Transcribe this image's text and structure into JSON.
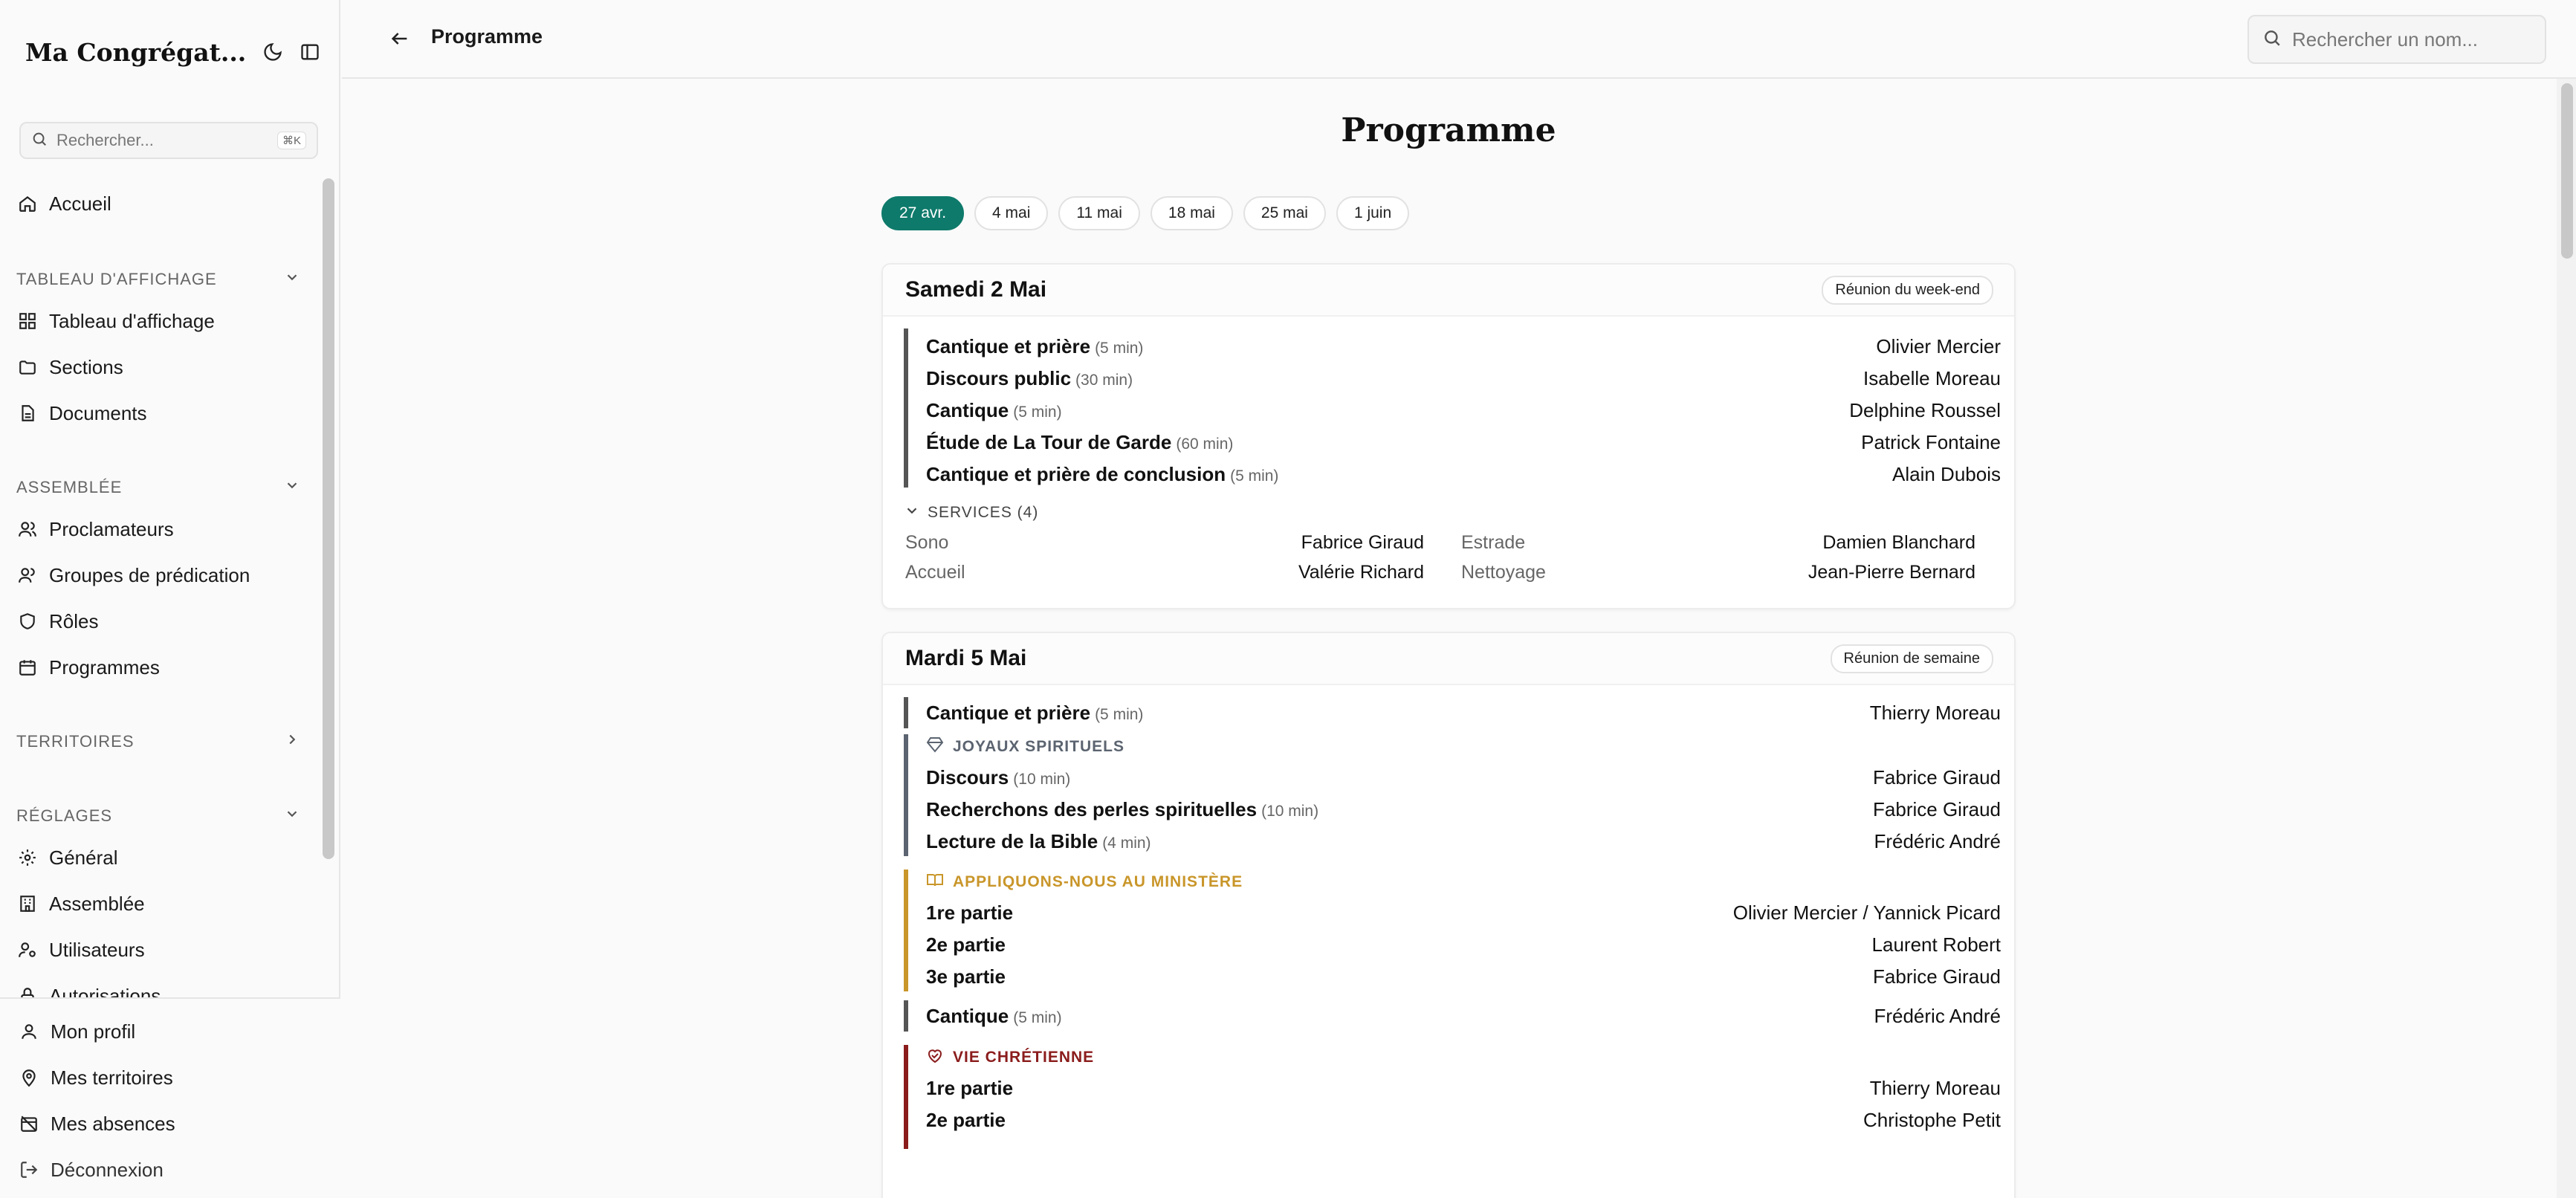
{
  "app": {
    "title": "Ma Congrégat..."
  },
  "sidebar": {
    "search_placeholder": "Rechercher...",
    "search_shortcut": "⌘K",
    "home": "Accueil",
    "groups": [
      {
        "label": "TABLEAU D'AFFICHAGE",
        "items": [
          "Tableau d'affichage",
          "Sections",
          "Documents"
        ]
      },
      {
        "label": "ASSEMBLÉE",
        "items": [
          "Proclamateurs",
          "Groupes de prédication",
          "Rôles",
          "Programmes"
        ]
      },
      {
        "label": "TERRITOIRES",
        "items": []
      },
      {
        "label": "RÉGLAGES",
        "items": [
          "Général",
          "Assemblée",
          "Utilisateurs",
          "Autorisations"
        ]
      }
    ],
    "footer": [
      "Mon profil",
      "Mes territoires",
      "Mes absences",
      "Déconnexion"
    ]
  },
  "header": {
    "title": "Programme",
    "search_placeholder": "Rechercher un nom..."
  },
  "main": {
    "title": "Programme",
    "weeks": [
      "27 avr.",
      "4 mai",
      "11 mai",
      "18 mai",
      "25 mai",
      "1 juin"
    ],
    "active_week": "27 avr."
  },
  "meetings": [
    {
      "title": "Samedi 2 Mai",
      "badge": "Réunion du week-end",
      "parts": [
        {
          "name": "Cantique et prière",
          "dur": "(5 min)",
          "who": "Olivier Mercier"
        },
        {
          "name": "Discours public",
          "dur": "(30 min)",
          "who": "Isabelle Moreau"
        },
        {
          "name": "Cantique",
          "dur": "(5 min)",
          "who": "Delphine Roussel"
        },
        {
          "name": "Étude de La Tour de Garde",
          "dur": "(60 min)",
          "who": "Patrick Fontaine"
        },
        {
          "name": "Cantique et prière de conclusion",
          "dur": "(5 min)",
          "who": "Alain Dubois"
        }
      ],
      "services_label": "SERVICES (4)",
      "services": [
        {
          "role": "Sono",
          "who": "Fabrice Giraud"
        },
        {
          "role": "Estrade",
          "who": "Damien Blanchard"
        },
        {
          "role": "Accueil",
          "who": "Valérie Richard"
        },
        {
          "role": "Nettoyage",
          "who": "Jean-Pierre Bernard"
        }
      ]
    },
    {
      "title": "Mardi 5 Mai",
      "badge": "Réunion de semaine",
      "opening": {
        "name": "Cantique et prière",
        "dur": "(5 min)",
        "who": "Thierry Moreau"
      },
      "joyaux": {
        "label": "JOYAUX SPIRITUELS",
        "parts": [
          {
            "name": "Discours",
            "dur": "(10 min)",
            "who": "Fabrice Giraud"
          },
          {
            "name": "Recherchons des perles spirituelles",
            "dur": "(10 min)",
            "who": "Fabrice Giraud"
          },
          {
            "name": "Lecture de la Bible",
            "dur": "(4 min)",
            "who": "Frédéric André"
          }
        ]
      },
      "ministere": {
        "label": "APPLIQUONS-NOUS AU MINISTÈRE",
        "parts": [
          {
            "name": "1re partie",
            "who": "Olivier Mercier / Yannick Picard"
          },
          {
            "name": "2e partie",
            "who": "Laurent Robert"
          },
          {
            "name": "3e partie",
            "who": "Fabrice Giraud"
          }
        ]
      },
      "cantique": {
        "name": "Cantique",
        "dur": "(5 min)",
        "who": "Frédéric André"
      },
      "vie": {
        "label": "VIE CHRÉTIENNE",
        "parts": [
          {
            "name": "1re partie",
            "who": "Thierry Moreau"
          },
          {
            "name": "2e partie",
            "who": "Christophe Petit"
          }
        ]
      }
    }
  ],
  "colors": {
    "accent": "#0e7a6b",
    "joyaux": "#5b6470",
    "ministere": "#c9962a",
    "vie": "#8b1c1c"
  }
}
